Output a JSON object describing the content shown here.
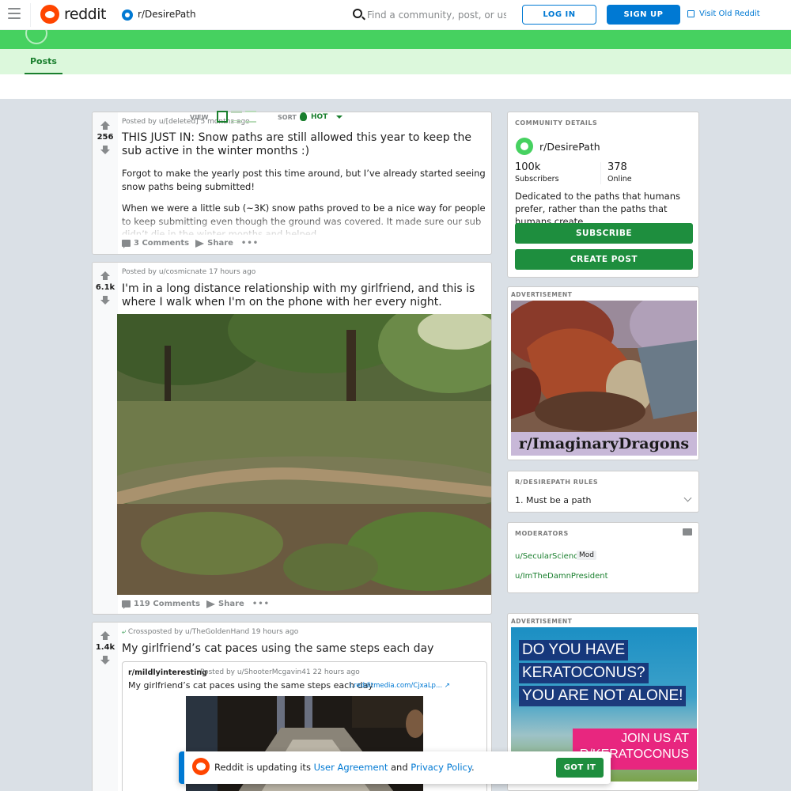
{
  "header": {
    "logo_text": "reddit",
    "subreddit": "r/DesirePath",
    "search_placeholder": "Find a community, post, or user",
    "login_label": "LOG IN",
    "signup_label": "SIGN UP",
    "old_reddit_label": "Visit Old Reddit"
  },
  "tabs": {
    "posts_label": "Posts"
  },
  "view_sort": {
    "view_label": "VIEW",
    "sort_label": "SORT",
    "sort_value": "HOT"
  },
  "posts": [
    {
      "score": "256",
      "meta": "Posted by u/[deleted] 5 months ago",
      "title": "THIS JUST IN: Snow paths are still allowed this year to keep the sub active in the winter months :)",
      "body": [
        "Forgot to make the yearly post this time around, but I’ve already started seeing snow paths being submitted!",
        "When we were a little sub (~3K) snow paths proved to be a nice way for people to keep submitting even though the ground was covered. It made sure our sub didn’t die in the winter months and helped"
      ],
      "comments": "3 Comments",
      "share": "Share"
    },
    {
      "score": "6.1k",
      "meta": "Posted by u/cosmicnate 17 hours ago",
      "title": "I'm in a long distance relationship with my girlfriend, and this is where I walk when I'm on the phone with her every night.",
      "comments": "119 Comments",
      "share": "Share"
    },
    {
      "score": "1.4k",
      "meta": "Crossposted by u/TheGoldenHand 19 hours ago",
      "title": "My girlfriend’s cat paces using the same steps each day",
      "crosspost": {
        "subreddit": "r/mildlyinteresting",
        "meta": "Posted by u/ShooterMcgavin41 22 hours ago",
        "title": "My girlfriend’s cat paces using the same steps each day",
        "link": "i.redditmedia.com/CjxaLp..."
      }
    }
  ],
  "sidebar": {
    "community": {
      "heading": "COMMUNITY DETAILS",
      "name": "r/DesirePath",
      "subscribers_value": "100k",
      "subscribers_label": "Subscribers",
      "online_value": "378",
      "online_label": "Online",
      "description": "Dedicated to the paths that humans prefer, rather than the paths that humans create.",
      "subscribe_label": "SUBSCRIBE",
      "create_post_label": "CREATE POST"
    },
    "ad1": {
      "label": "ADVERTISEMENT",
      "caption": "r/ImaginaryDragons"
    },
    "rules": {
      "heading": "R/DESIREPATH RULES",
      "items": [
        "1. Must be a path"
      ]
    },
    "moderators": {
      "heading": "MODERATORS",
      "items": [
        {
          "name": "u/SecularScience",
          "flair": "Mod"
        },
        {
          "name": "u/ImTheDamnPresident",
          "flair": ""
        }
      ]
    },
    "ad2": {
      "label": "ADVERTISEMENT",
      "lines": [
        "DO YOU HAVE",
        "KERATOCONUS?",
        "YOU ARE NOT ALONE!"
      ],
      "join_lines": [
        "JOIN US AT",
        "R/KERATOCONUS"
      ]
    }
  },
  "toast": {
    "prefix": "Reddit is updating its",
    "link1": "User Agreement",
    "and": "and",
    "link2": "Privacy Policy",
    "suffix": ".",
    "button": "GOT IT"
  }
}
